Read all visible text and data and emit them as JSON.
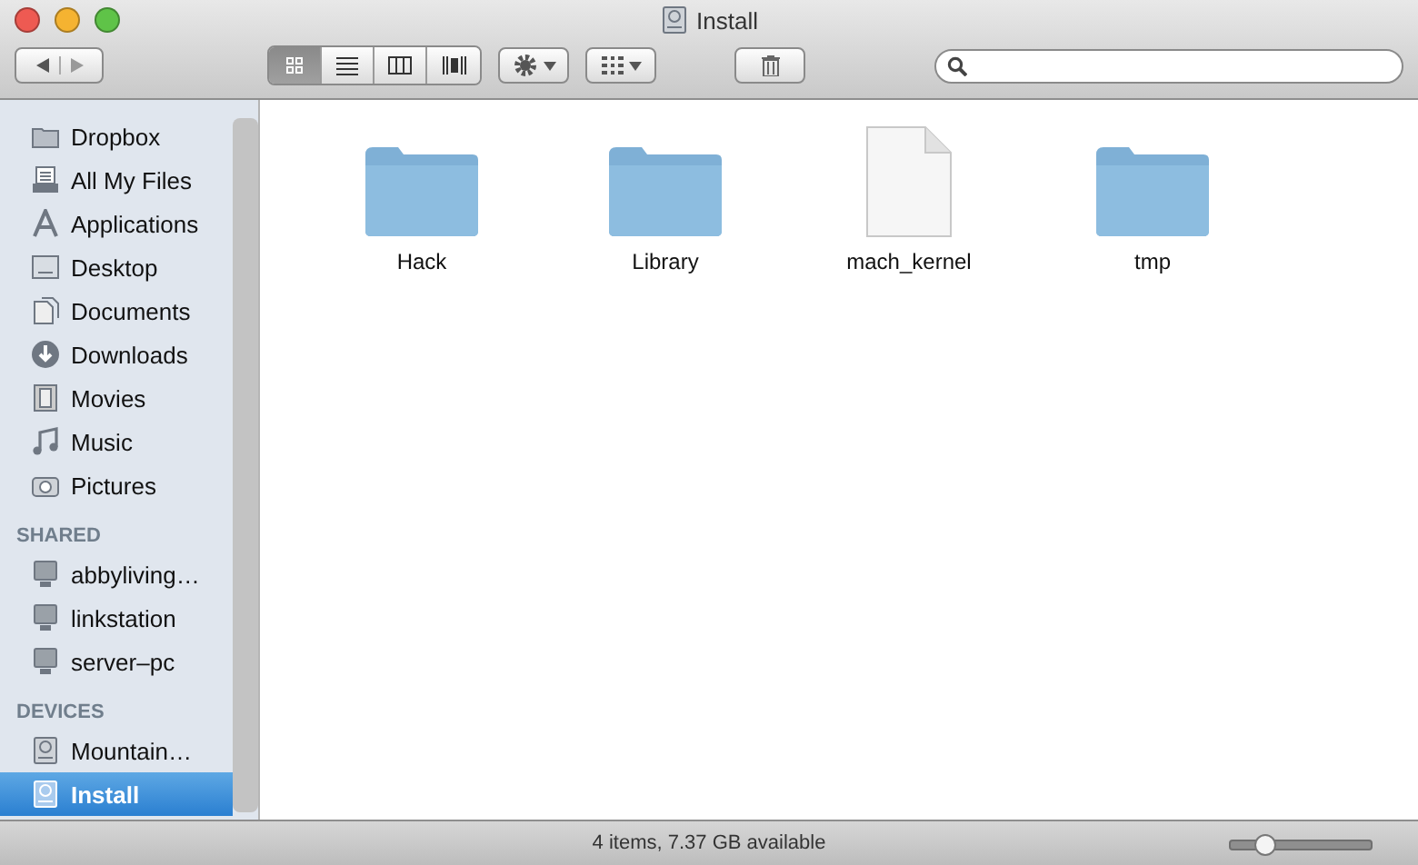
{
  "window": {
    "title": "Install"
  },
  "toolbar": {
    "view_buttons": [
      {
        "kind": "icons",
        "selected": true
      },
      {
        "kind": "list",
        "selected": false
      },
      {
        "kind": "columns",
        "selected": false
      },
      {
        "kind": "coverflow",
        "selected": false
      }
    ]
  },
  "sidebar": {
    "sections": [
      {
        "items": [
          {
            "label": "Dropbox",
            "kind": "folder",
            "selected": false
          },
          {
            "label": "All My Files",
            "kind": "files",
            "selected": false
          },
          {
            "label": "Applications",
            "kind": "applications",
            "selected": false
          },
          {
            "label": "Desktop",
            "kind": "desktop",
            "selected": false
          },
          {
            "label": "Documents",
            "kind": "documents",
            "selected": false
          },
          {
            "label": "Downloads",
            "kind": "downloads",
            "selected": false
          },
          {
            "label": "Movies",
            "kind": "movies",
            "selected": false
          },
          {
            "label": "Music",
            "kind": "music",
            "selected": false
          },
          {
            "label": "Pictures",
            "kind": "pictures",
            "selected": false
          }
        ]
      },
      {
        "heading": "SHARED",
        "items": [
          {
            "label": "abbyliving…",
            "kind": "computer",
            "selected": false
          },
          {
            "label": "linkstation",
            "kind": "computer",
            "selected": false
          },
          {
            "label": "server–pc",
            "kind": "computer",
            "selected": false
          }
        ]
      },
      {
        "heading": "DEVICES",
        "items": [
          {
            "label": "Mountain…",
            "kind": "disk",
            "selected": false
          },
          {
            "label": "Install",
            "kind": "disk",
            "selected": true
          }
        ]
      }
    ]
  },
  "files": [
    {
      "name": "Hack",
      "kind": "folder"
    },
    {
      "name": "Library",
      "kind": "folder"
    },
    {
      "name": "mach_kernel",
      "kind": "document"
    },
    {
      "name": "tmp",
      "kind": "folder"
    }
  ],
  "status_bar": {
    "text": "4 items, 7.37 GB available",
    "icon_size": {
      "level": 0.25
    }
  }
}
